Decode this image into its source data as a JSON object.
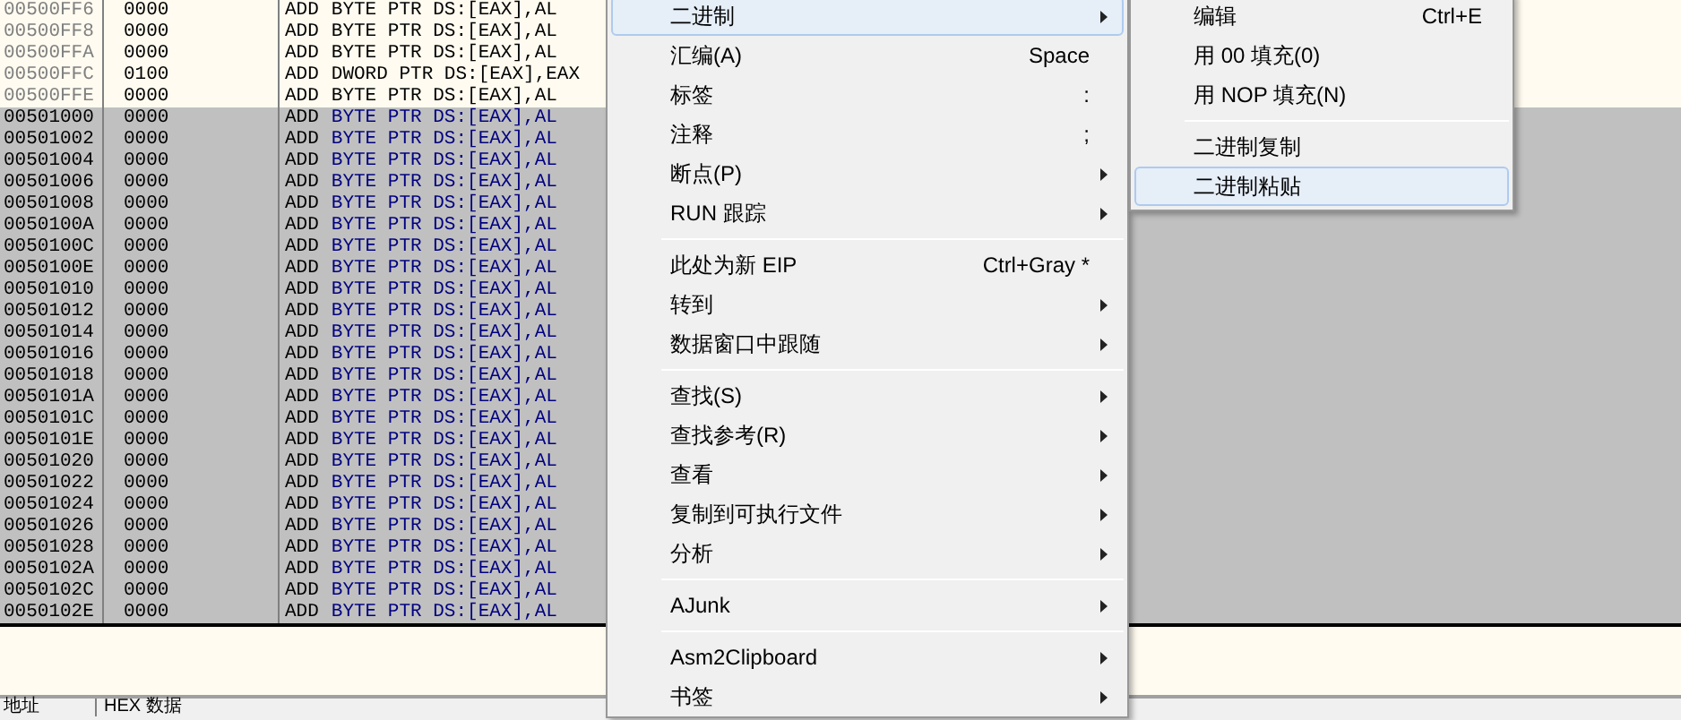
{
  "disassembly": {
    "rows": [
      {
        "address": "00500FF6",
        "hex": "0000",
        "mnemonic": "ADD",
        "operands": "BYTE PTR DS:[EAX],AL",
        "selected": false
      },
      {
        "address": "00500FF8",
        "hex": "0000",
        "mnemonic": "ADD",
        "operands": "BYTE PTR DS:[EAX],AL",
        "selected": false
      },
      {
        "address": "00500FFA",
        "hex": "0000",
        "mnemonic": "ADD",
        "operands": "BYTE PTR DS:[EAX],AL",
        "selected": false
      },
      {
        "address": "00500FFC",
        "hex": "0100",
        "mnemonic": "ADD",
        "operands": "DWORD PTR DS:[EAX],EAX",
        "selected": false
      },
      {
        "address": "00500FFE",
        "hex": "0000",
        "mnemonic": "ADD",
        "operands": "BYTE PTR DS:[EAX],AL",
        "selected": false
      },
      {
        "address": "00501000",
        "hex": "0000",
        "mnemonic": "ADD",
        "operands": "BYTE PTR DS:[EAX],AL",
        "selected": true
      },
      {
        "address": "00501002",
        "hex": "0000",
        "mnemonic": "ADD",
        "operands": "BYTE PTR DS:[EAX],AL",
        "selected": true
      },
      {
        "address": "00501004",
        "hex": "0000",
        "mnemonic": "ADD",
        "operands": "BYTE PTR DS:[EAX],AL",
        "selected": true
      },
      {
        "address": "00501006",
        "hex": "0000",
        "mnemonic": "ADD",
        "operands": "BYTE PTR DS:[EAX],AL",
        "selected": true
      },
      {
        "address": "00501008",
        "hex": "0000",
        "mnemonic": "ADD",
        "operands": "BYTE PTR DS:[EAX],AL",
        "selected": true
      },
      {
        "address": "0050100A",
        "hex": "0000",
        "mnemonic": "ADD",
        "operands": "BYTE PTR DS:[EAX],AL",
        "selected": true
      },
      {
        "address": "0050100C",
        "hex": "0000",
        "mnemonic": "ADD",
        "operands": "BYTE PTR DS:[EAX],AL",
        "selected": true
      },
      {
        "address": "0050100E",
        "hex": "0000",
        "mnemonic": "ADD",
        "operands": "BYTE PTR DS:[EAX],AL",
        "selected": true
      },
      {
        "address": "00501010",
        "hex": "0000",
        "mnemonic": "ADD",
        "operands": "BYTE PTR DS:[EAX],AL",
        "selected": true
      },
      {
        "address": "00501012",
        "hex": "0000",
        "mnemonic": "ADD",
        "operands": "BYTE PTR DS:[EAX],AL",
        "selected": true
      },
      {
        "address": "00501014",
        "hex": "0000",
        "mnemonic": "ADD",
        "operands": "BYTE PTR DS:[EAX],AL",
        "selected": true
      },
      {
        "address": "00501016",
        "hex": "0000",
        "mnemonic": "ADD",
        "operands": "BYTE PTR DS:[EAX],AL",
        "selected": true
      },
      {
        "address": "00501018",
        "hex": "0000",
        "mnemonic": "ADD",
        "operands": "BYTE PTR DS:[EAX],AL",
        "selected": true
      },
      {
        "address": "0050101A",
        "hex": "0000",
        "mnemonic": "ADD",
        "operands": "BYTE PTR DS:[EAX],AL",
        "selected": true
      },
      {
        "address": "0050101C",
        "hex": "0000",
        "mnemonic": "ADD",
        "operands": "BYTE PTR DS:[EAX],AL",
        "selected": true
      },
      {
        "address": "0050101E",
        "hex": "0000",
        "mnemonic": "ADD",
        "operands": "BYTE PTR DS:[EAX],AL",
        "selected": true
      },
      {
        "address": "00501020",
        "hex": "0000",
        "mnemonic": "ADD",
        "operands": "BYTE PTR DS:[EAX],AL",
        "selected": true
      },
      {
        "address": "00501022",
        "hex": "0000",
        "mnemonic": "ADD",
        "operands": "BYTE PTR DS:[EAX],AL",
        "selected": true
      },
      {
        "address": "00501024",
        "hex": "0000",
        "mnemonic": "ADD",
        "operands": "BYTE PTR DS:[EAX],AL",
        "selected": true
      },
      {
        "address": "00501026",
        "hex": "0000",
        "mnemonic": "ADD",
        "operands": "BYTE PTR DS:[EAX],AL",
        "selected": true
      },
      {
        "address": "00501028",
        "hex": "0000",
        "mnemonic": "ADD",
        "operands": "BYTE PTR DS:[EAX],AL",
        "selected": true
      },
      {
        "address": "0050102A",
        "hex": "0000",
        "mnemonic": "ADD",
        "operands": "BYTE PTR DS:[EAX],AL",
        "selected": true
      },
      {
        "address": "0050102C",
        "hex": "0000",
        "mnemonic": "ADD",
        "operands": "BYTE PTR DS:[EAX],AL",
        "selected": true
      },
      {
        "address": "0050102E",
        "hex": "0000",
        "mnemonic": "ADD",
        "operands": "BYTE PTR DS:[EAX],AL",
        "selected": true
      }
    ]
  },
  "dump_header": {
    "column_1": "地址",
    "column_2": "HEX 数据"
  },
  "context_menu": {
    "groups": [
      [
        {
          "label": "二进制",
          "submenu": true,
          "selected": true
        },
        {
          "label": "汇编(A)",
          "shortcut": "Space",
          "submenu": false,
          "selected": false
        },
        {
          "label": "标签",
          "shortcut": ":",
          "submenu": false,
          "selected": false
        },
        {
          "label": "注释",
          "shortcut": ";",
          "submenu": false,
          "selected": false
        },
        {
          "label": "断点(P)",
          "submenu": true,
          "selected": false
        },
        {
          "label": "RUN 跟踪",
          "submenu": true,
          "selected": false
        }
      ],
      [
        {
          "label": "此处为新 EIP",
          "shortcut": "Ctrl+Gray *",
          "submenu": false,
          "selected": false
        },
        {
          "label": "转到",
          "submenu": true,
          "selected": false
        },
        {
          "label": "数据窗口中跟随",
          "submenu": true,
          "selected": false
        }
      ],
      [
        {
          "label": "查找(S)",
          "submenu": true,
          "selected": false
        },
        {
          "label": "查找参考(R)",
          "submenu": true,
          "selected": false
        },
        {
          "label": "查看",
          "submenu": true,
          "selected": false
        },
        {
          "label": "复制到可执行文件",
          "submenu": true,
          "selected": false
        },
        {
          "label": "分析",
          "submenu": true,
          "selected": false
        }
      ],
      [
        {
          "label": "AJunk",
          "submenu": true,
          "selected": false
        }
      ],
      [
        {
          "label": "Asm2Clipboard",
          "submenu": true,
          "selected": false
        },
        {
          "label": "书签",
          "submenu": true,
          "selected": false
        }
      ]
    ]
  },
  "submenu": {
    "groups": [
      [
        {
          "label": "编辑",
          "shortcut": "Ctrl+E",
          "selected": false
        },
        {
          "label": "用 00 填充(0)",
          "selected": false
        },
        {
          "label": "用 NOP 填充(N)",
          "selected": false
        }
      ],
      [
        {
          "label": "二进制复制",
          "selected": false
        },
        {
          "label": "二进制粘贴",
          "selected": true
        }
      ]
    ]
  }
}
